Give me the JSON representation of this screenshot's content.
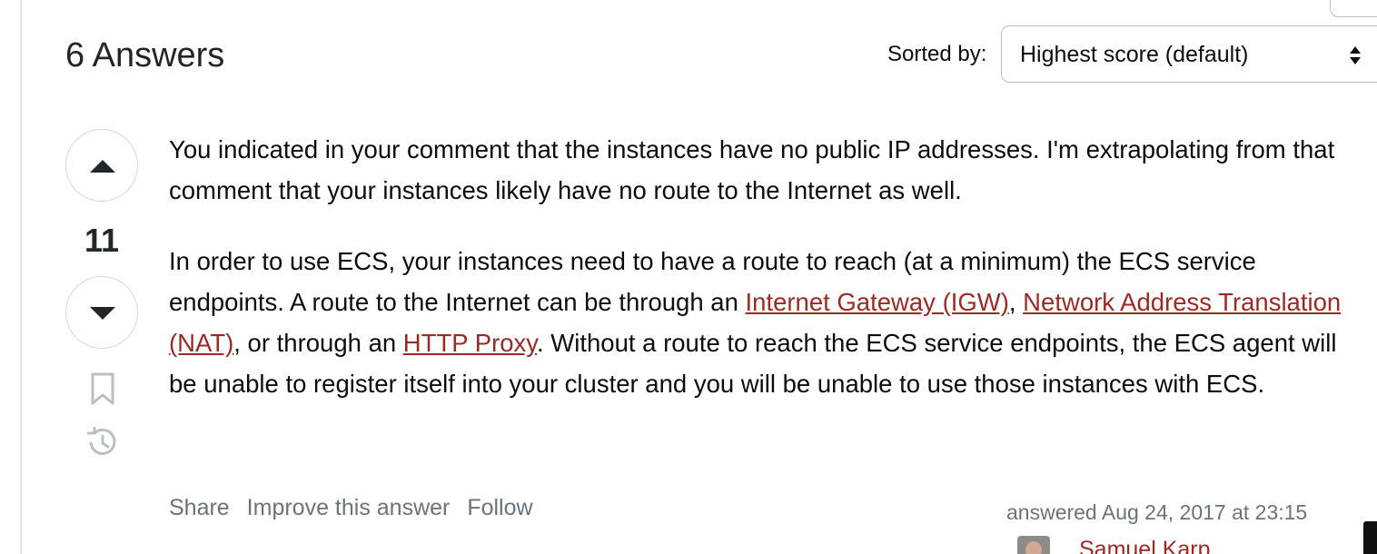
{
  "answers_header": "6 Answers",
  "sort": {
    "label": "Sorted by:",
    "selected": "Highest score (default)"
  },
  "vote": {
    "count": "11"
  },
  "answer": {
    "p1": "You indicated in your comment that the instances have no public IP addresses. I'm extrapolating from that comment that your instances likely have no route to the Internet as well.",
    "p2_a": "In order to use ECS, your instances need to have a route to reach (at a minimum) the ECS service endpoints. A route to the Internet can be through an ",
    "link_igw": "Internet Gateway (IGW)",
    "p2_b": ", ",
    "link_nat": "Network Address Translation (NAT)",
    "p2_c": ", or through an ",
    "link_proxy": "HTTP Proxy",
    "p2_d": ". Without a route to reach the ECS service endpoints, the ECS agent will be unable to register itself into your cluster and you will be unable to use those instances with ECS."
  },
  "post_menu": {
    "share": "Share",
    "improve": "Improve this answer",
    "follow": "Follow"
  },
  "signature": {
    "action_time": "answered Aug 24, 2017 at 23:15",
    "user_name": "Samuel Karp"
  },
  "icons": {
    "vote_up": "triangle-up-icon",
    "vote_down": "triangle-down-icon",
    "bookmark": "bookmark-icon",
    "history": "history-icon",
    "sort_arrows": "sort-arrows-icon"
  },
  "colors": {
    "link": "#9b2a24",
    "muted_text": "#6a737c",
    "border": "#d6d9dc"
  }
}
